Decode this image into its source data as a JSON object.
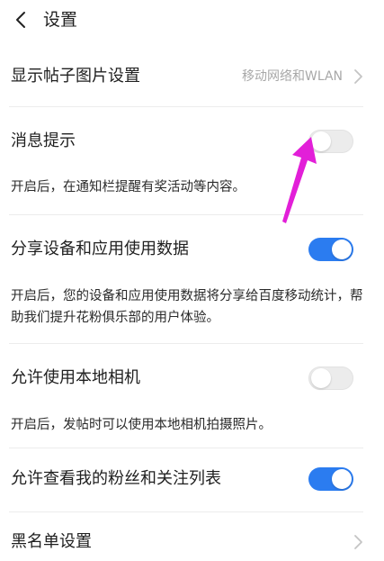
{
  "header": {
    "title": "设置"
  },
  "rows": {
    "image_settings": {
      "label": "显示帖子图片设置",
      "value": "移动网络和WLAN"
    },
    "notifications": {
      "label": "消息提示",
      "description": "开启后，在通知栏提醒有奖活动等内容。",
      "enabled": false
    },
    "share_data": {
      "label": "分享设备和应用使用数据",
      "description": "开启后，您的设备和应用使用数据将分享给百度移动统计，帮助我们提升花粉俱乐部的用户体验。",
      "enabled": true
    },
    "local_camera": {
      "label": "允许使用本地相机",
      "description": "开启后，发帖时可以使用本地相机拍摄照片。",
      "enabled": false
    },
    "fans_list": {
      "label": "允许查看我的粉丝和关注列表",
      "enabled": true
    },
    "blacklist": {
      "label": "黑名单设置"
    }
  },
  "colors": {
    "toggle_on": "#2b7cf0",
    "toggle_off": "#ececec",
    "annotation_arrow": "#e21fd8",
    "secondary_text": "#a8a8a8"
  },
  "icons": {
    "back": "chevron-left-icon",
    "row_chevron": "chevron-right-icon"
  }
}
